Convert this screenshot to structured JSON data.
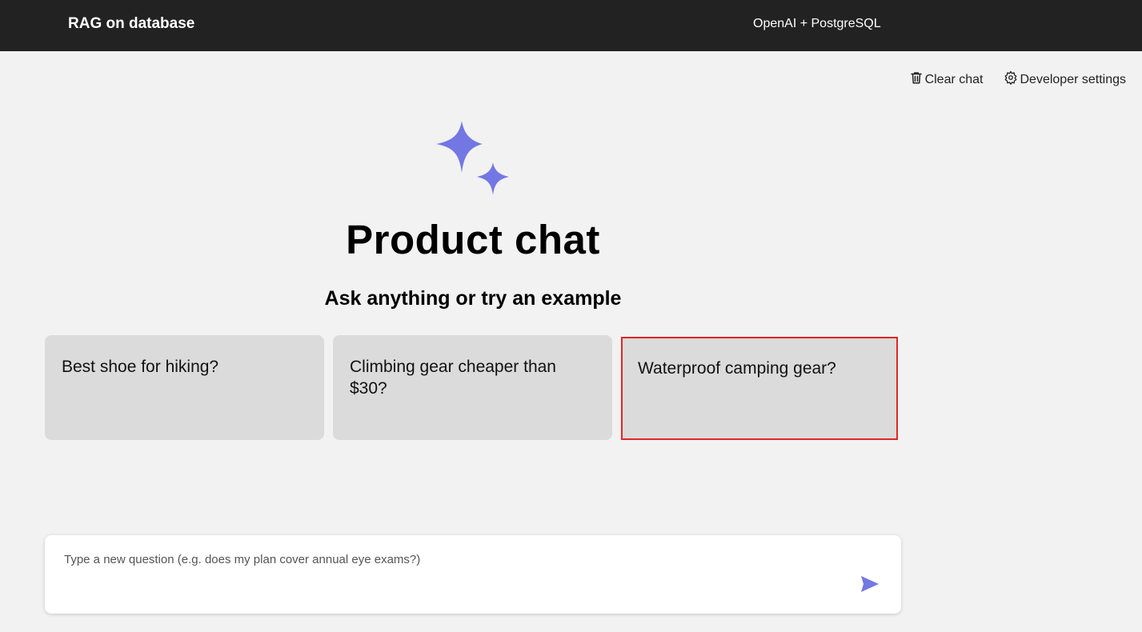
{
  "header": {
    "title": "RAG on database",
    "subtitle": "OpenAI + PostgreSQL"
  },
  "commands": {
    "clear_chat": "Clear chat",
    "developer_settings": "Developer settings"
  },
  "chat": {
    "title": "Product chat",
    "subtitle": "Ask anything or try an example"
  },
  "examples": [
    {
      "text": "Best shoe for hiking?"
    },
    {
      "text": "Climbing gear cheaper than $30?"
    },
    {
      "text": "Waterproof camping gear?"
    }
  ],
  "composer": {
    "placeholder": "Type a new question (e.g. does my plan cover annual eye exams?)",
    "send_icon": "send-icon"
  },
  "colors": {
    "header_bg": "#222222",
    "accent": "#7377e3",
    "example_bg": "#dbdbdb",
    "selection_border": "#e32626"
  }
}
